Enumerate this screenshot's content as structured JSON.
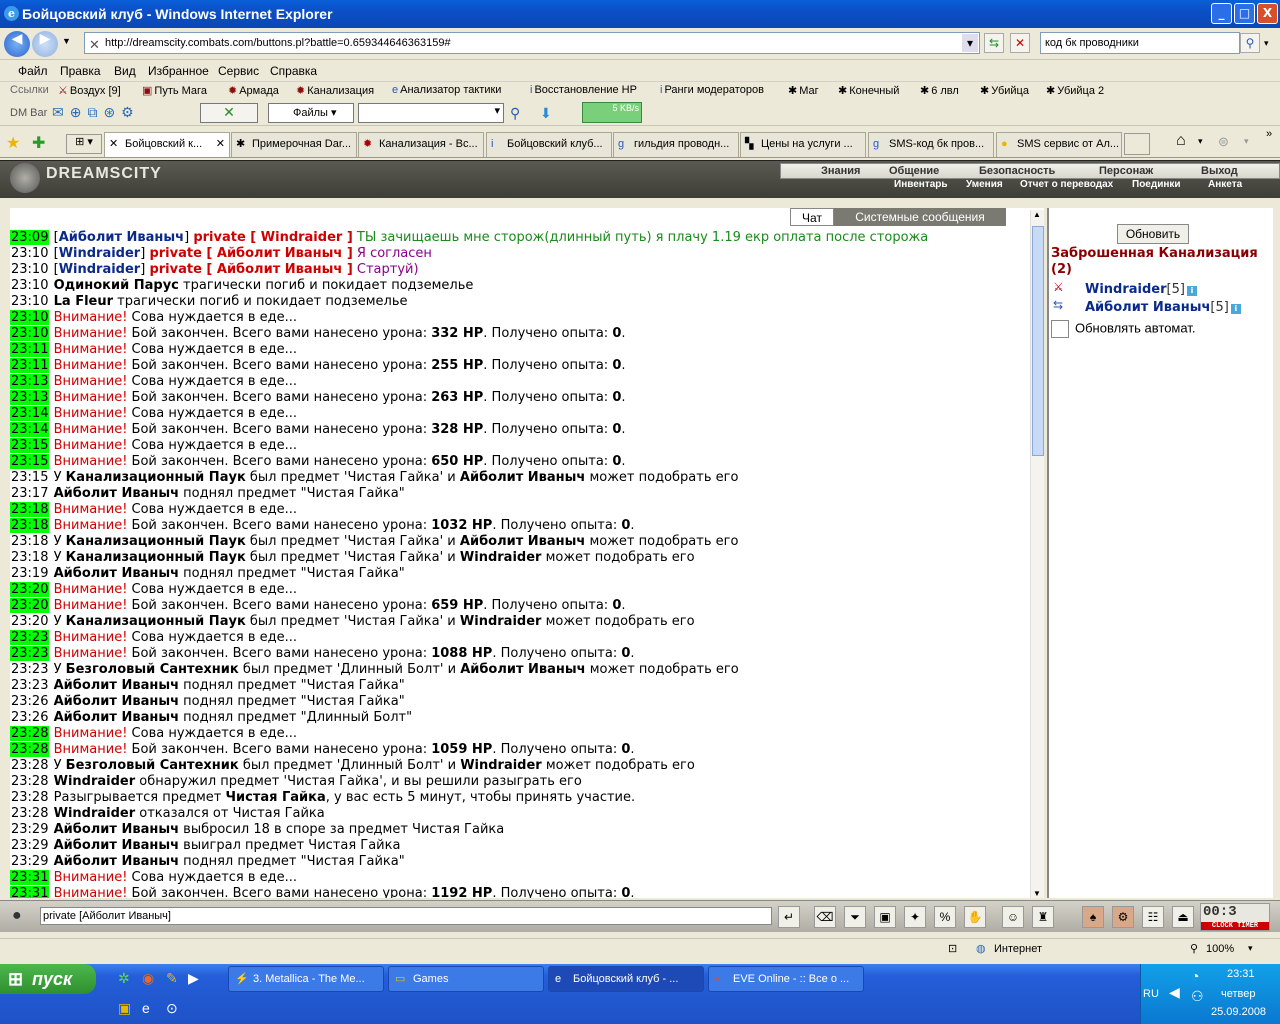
{
  "window": {
    "title": "Бойцовский клуб - Windows Internet Explorer",
    "min": "_",
    "max": "□",
    "close": "X"
  },
  "address": {
    "url": "http://dreamscity.combats.com/buttons.pl?battle=0.659344646363159#",
    "search": "код бк проводники"
  },
  "menu": [
    "Файл",
    "Правка",
    "Вид",
    "Избранное",
    "Сервис",
    "Справка"
  ],
  "links": {
    "label": "Ссылки",
    "items": [
      "Воздух [9]",
      "Путь Мага",
      "Армада",
      "Канализация",
      "Анализатор тактики",
      "Восстановление НР",
      "Ранги модераторов",
      "Маг",
      "Конечный",
      "6 лвл",
      "Убийца",
      "Убийца 2"
    ]
  },
  "dmbar": {
    "label": "DM Bar",
    "files": "Файлы",
    "speed": "5 KB/s"
  },
  "tabs": [
    "Бойцовский к...",
    "Примерочная Dar...",
    "Канализация - Вс...",
    "Бойцовский клуб...",
    "гильдия проводн...",
    "Цены на услуги ...",
    "SMS-код бк пров...",
    "SMS сервис от Ал..."
  ],
  "game": {
    "logo": "DREAMSCITY",
    "nav_top": [
      "Знания",
      "Общение",
      "Безопасность",
      "Персонаж",
      "Выход"
    ],
    "nav_bottom": [
      "Инвентарь",
      "Умения",
      "Отчет о переводах",
      "Поединки",
      "Анкета"
    ],
    "chat_tabs": [
      "Чат",
      "Системные сообщения"
    ]
  },
  "chat": [
    {
      "t": "23:09",
      "g": true,
      "parts": [
        [
          "",
          "["
        ],
        [
          "nm",
          "Айболит Иваныч"
        ],
        [
          "",
          "] "
        ],
        [
          "pr",
          "private [ Windraider ]"
        ],
        [
          "msg",
          " ТЫ зачищаешь мне сторож(длинный путь) я плачу 1.19 екр оплата после сторожа"
        ]
      ]
    },
    {
      "t": "23:10",
      "g": false,
      "parts": [
        [
          "",
          "["
        ],
        [
          "nm",
          "Windraider"
        ],
        [
          "",
          "] "
        ],
        [
          "pr",
          "private [ Айболит Иваныч ]"
        ],
        [
          "msg p",
          " Я согласен"
        ]
      ]
    },
    {
      "t": "23:10",
      "g": false,
      "parts": [
        [
          "",
          "["
        ],
        [
          "nm",
          "Windraider"
        ],
        [
          "",
          "] "
        ],
        [
          "pr",
          "private [ Айболит Иваныч ]"
        ],
        [
          "msg p",
          " Стартуй)"
        ]
      ]
    },
    {
      "t": "23:10",
      "g": false,
      "parts": [
        [
          "b",
          "Одинокий Парус"
        ],
        [
          "",
          " трагически погиб и покидает подземелье"
        ]
      ]
    },
    {
      "t": "23:10",
      "g": false,
      "parts": [
        [
          "b",
          "La Fleur"
        ],
        [
          "",
          " трагически погиб и покидает подземелье"
        ]
      ]
    },
    {
      "t": "23:10",
      "g": true,
      "parts": [
        [
          "warn",
          "Внимание!"
        ],
        [
          "",
          " Сова нуждается в еде..."
        ]
      ]
    },
    {
      "t": "23:10",
      "g": true,
      "parts": [
        [
          "warn",
          "Внимание!"
        ],
        [
          "",
          " Бой закончен. Всего вами нанесено урона: "
        ],
        [
          "b",
          "332 HP"
        ],
        [
          "",
          ". Получено опыта: "
        ],
        [
          "b",
          "0"
        ],
        [
          "",
          "."
        ]
      ]
    },
    {
      "t": "23:11",
      "g": true,
      "parts": [
        [
          "warn",
          "Внимание!"
        ],
        [
          "",
          " Сова нуждается в еде..."
        ]
      ]
    },
    {
      "t": "23:11",
      "g": true,
      "parts": [
        [
          "warn",
          "Внимание!"
        ],
        [
          "",
          " Бой закончен. Всего вами нанесено урона: "
        ],
        [
          "b",
          "255 HP"
        ],
        [
          "",
          ". Получено опыта: "
        ],
        [
          "b",
          "0"
        ],
        [
          "",
          "."
        ]
      ]
    },
    {
      "t": "23:13",
      "g": true,
      "parts": [
        [
          "warn",
          "Внимание!"
        ],
        [
          "",
          " Сова нуждается в еде..."
        ]
      ]
    },
    {
      "t": "23:13",
      "g": true,
      "parts": [
        [
          "warn",
          "Внимание!"
        ],
        [
          "",
          " Бой закончен. Всего вами нанесено урона: "
        ],
        [
          "b",
          "263 HP"
        ],
        [
          "",
          ". Получено опыта: "
        ],
        [
          "b",
          "0"
        ],
        [
          "",
          "."
        ]
      ]
    },
    {
      "t": "23:14",
      "g": true,
      "parts": [
        [
          "warn",
          "Внимание!"
        ],
        [
          "",
          " Сова нуждается в еде..."
        ]
      ]
    },
    {
      "t": "23:14",
      "g": true,
      "parts": [
        [
          "warn",
          "Внимание!"
        ],
        [
          "",
          " Бой закончен. Всего вами нанесено урона: "
        ],
        [
          "b",
          "328 HP"
        ],
        [
          "",
          ". Получено опыта: "
        ],
        [
          "b",
          "0"
        ],
        [
          "",
          "."
        ]
      ]
    },
    {
      "t": "23:15",
      "g": true,
      "parts": [
        [
          "warn",
          "Внимание!"
        ],
        [
          "",
          " Сова нуждается в еде..."
        ]
      ]
    },
    {
      "t": "23:15",
      "g": true,
      "parts": [
        [
          "warn",
          "Внимание!"
        ],
        [
          "",
          " Бой закончен. Всего вами нанесено урона: "
        ],
        [
          "b",
          "650 HP"
        ],
        [
          "",
          ". Получено опыта: "
        ],
        [
          "b",
          "0"
        ],
        [
          "",
          "."
        ]
      ]
    },
    {
      "t": "23:15",
      "g": false,
      "parts": [
        [
          "",
          "У "
        ],
        [
          "b",
          "Канализационный Паук"
        ],
        [
          "",
          " был предмет 'Чистая Гайка' и "
        ],
        [
          "b",
          "Айболит Иваныч"
        ],
        [
          "",
          " может подобрать его"
        ]
      ]
    },
    {
      "t": "23:17",
      "g": false,
      "parts": [
        [
          "b",
          "Айболит Иваныч"
        ],
        [
          "",
          " поднял предмет \"Чистая Гайка\""
        ]
      ]
    },
    {
      "t": "23:18",
      "g": true,
      "parts": [
        [
          "warn",
          "Внимание!"
        ],
        [
          "",
          " Сова нуждается в еде..."
        ]
      ]
    },
    {
      "t": "23:18",
      "g": true,
      "parts": [
        [
          "warn",
          "Внимание!"
        ],
        [
          "",
          " Бой закончен. Всего вами нанесено урона: "
        ],
        [
          "b",
          "1032 HP"
        ],
        [
          "",
          ". Получено опыта: "
        ],
        [
          "b",
          "0"
        ],
        [
          "",
          "."
        ]
      ]
    },
    {
      "t": "23:18",
      "g": false,
      "parts": [
        [
          "",
          "У "
        ],
        [
          "b",
          "Канализационный Паук"
        ],
        [
          "",
          " был предмет 'Чистая Гайка' и "
        ],
        [
          "b",
          "Айболит Иваныч"
        ],
        [
          "",
          " может подобрать его"
        ]
      ]
    },
    {
      "t": "23:18",
      "g": false,
      "parts": [
        [
          "",
          "У "
        ],
        [
          "b",
          "Канализационный Паук"
        ],
        [
          "",
          " был предмет 'Чистая Гайка' и "
        ],
        [
          "b",
          "Windraider"
        ],
        [
          "",
          " может подобрать его"
        ]
      ]
    },
    {
      "t": "23:19",
      "g": false,
      "parts": [
        [
          "b",
          "Айболит Иваныч"
        ],
        [
          "",
          " поднял предмет \"Чистая Гайка\""
        ]
      ]
    },
    {
      "t": "23:20",
      "g": true,
      "parts": [
        [
          "warn",
          "Внимание!"
        ],
        [
          "",
          " Сова нуждается в еде..."
        ]
      ]
    },
    {
      "t": "23:20",
      "g": true,
      "parts": [
        [
          "warn",
          "Внимание!"
        ],
        [
          "",
          " Бой закончен. Всего вами нанесено урона: "
        ],
        [
          "b",
          "659 HP"
        ],
        [
          "",
          ". Получено опыта: "
        ],
        [
          "b",
          "0"
        ],
        [
          "",
          "."
        ]
      ]
    },
    {
      "t": "23:20",
      "g": false,
      "parts": [
        [
          "",
          "У "
        ],
        [
          "b",
          "Канализационный Паук"
        ],
        [
          "",
          " был предмет 'Чистая Гайка' и "
        ],
        [
          "b",
          "Windraider"
        ],
        [
          "",
          " может подобрать его"
        ]
      ]
    },
    {
      "t": "23:23",
      "g": true,
      "parts": [
        [
          "warn",
          "Внимание!"
        ],
        [
          "",
          " Сова нуждается в еде..."
        ]
      ]
    },
    {
      "t": "23:23",
      "g": true,
      "parts": [
        [
          "warn",
          "Внимание!"
        ],
        [
          "",
          " Бой закончен. Всего вами нанесено урона: "
        ],
        [
          "b",
          "1088 HP"
        ],
        [
          "",
          ". Получено опыта: "
        ],
        [
          "b",
          "0"
        ],
        [
          "",
          "."
        ]
      ]
    },
    {
      "t": "23:23",
      "g": false,
      "parts": [
        [
          "",
          "У "
        ],
        [
          "b",
          "Безголовый Сантехник"
        ],
        [
          "",
          " был предмет 'Длинный Болт' и "
        ],
        [
          "b",
          "Айболит Иваныч"
        ],
        [
          "",
          " может подобрать его"
        ]
      ]
    },
    {
      "t": "23:23",
      "g": false,
      "parts": [
        [
          "b",
          "Айболит Иваныч"
        ],
        [
          "",
          " поднял предмет \"Чистая Гайка\""
        ]
      ]
    },
    {
      "t": "23:26",
      "g": false,
      "parts": [
        [
          "b",
          "Айболит Иваныч"
        ],
        [
          "",
          " поднял предмет \"Чистая Гайка\""
        ]
      ]
    },
    {
      "t": "23:26",
      "g": false,
      "parts": [
        [
          "b",
          "Айболит Иваныч"
        ],
        [
          "",
          " поднял предмет \"Длинный Болт\""
        ]
      ]
    },
    {
      "t": "23:28",
      "g": true,
      "parts": [
        [
          "warn",
          "Внимание!"
        ],
        [
          "",
          " Сова нуждается в еде..."
        ]
      ]
    },
    {
      "t": "23:28",
      "g": true,
      "parts": [
        [
          "warn",
          "Внимание!"
        ],
        [
          "",
          " Бой закончен. Всего вами нанесено урона: "
        ],
        [
          "b",
          "1059 HP"
        ],
        [
          "",
          ". Получено опыта: "
        ],
        [
          "b",
          "0"
        ],
        [
          "",
          "."
        ]
      ]
    },
    {
      "t": "23:28",
      "g": false,
      "parts": [
        [
          "",
          "У "
        ],
        [
          "b",
          "Безголовый Сантехник"
        ],
        [
          "",
          " был предмет 'Длинный Болт' и "
        ],
        [
          "b",
          "Windraider"
        ],
        [
          "",
          " может подобрать его"
        ]
      ]
    },
    {
      "t": "23:28",
      "g": false,
      "parts": [
        [
          "b",
          "Windraider"
        ],
        [
          "",
          " обнаружил предмет 'Чистая Гайка', и вы решили разыграть его"
        ]
      ]
    },
    {
      "t": "23:28",
      "g": false,
      "parts": [
        [
          "",
          "Разыгрывается предмет "
        ],
        [
          "b",
          "Чистая Гайка"
        ],
        [
          "",
          ", у вас есть 5 минут, чтобы принять участие."
        ]
      ]
    },
    {
      "t": "23:28",
      "g": false,
      "parts": [
        [
          "b",
          "Windraider"
        ],
        [
          "",
          " отказался от Чистая Гайка"
        ]
      ]
    },
    {
      "t": "23:29",
      "g": false,
      "parts": [
        [
          "b",
          "Айболит Иваныч"
        ],
        [
          "",
          " выбросил 18 в споре за предмет Чистая Гайка"
        ]
      ]
    },
    {
      "t": "23:29",
      "g": false,
      "parts": [
        [
          "b",
          "Айболит Иваныч"
        ],
        [
          "",
          " выиграл предмет Чистая Гайка"
        ]
      ]
    },
    {
      "t": "23:29",
      "g": false,
      "parts": [
        [
          "b",
          "Айболит Иваныч"
        ],
        [
          "",
          " поднял предмет \"Чистая Гайка\""
        ]
      ]
    },
    {
      "t": "23:31",
      "g": true,
      "parts": [
        [
          "warn",
          "Внимание!"
        ],
        [
          "",
          " Сова нуждается в еде..."
        ]
      ]
    },
    {
      "t": "23:31",
      "g": true,
      "parts": [
        [
          "warn",
          "Внимание!"
        ],
        [
          "",
          " Бой закончен. Всего вами нанесено урона: "
        ],
        [
          "b",
          "1192 HP"
        ],
        [
          "",
          ". Получено опыта: "
        ],
        [
          "b",
          "0"
        ],
        [
          "",
          "."
        ]
      ]
    }
  ],
  "panel": {
    "refresh": "Обновить",
    "location": "Заброшенная Канализация (2)",
    "people": [
      {
        "name": "Windraider",
        "level": "[5]"
      },
      {
        "name": "Айболит Иваныч",
        "level": "[5]"
      }
    ],
    "auto": "Обновлять автомат."
  },
  "input": {
    "value": "private [Айболит Иваныч]"
  },
  "clock": {
    "value": "00:3",
    "label": "CLOCK TIMER"
  },
  "status": {
    "zone": "Интернет",
    "zoom": "100%"
  },
  "taskbar": {
    "start": "пуск",
    "tasks": [
      "3. Metallica - The Me...",
      "Games",
      "Бойцовский клуб - ...",
      "EVE Online - :: Все о ..."
    ],
    "lang": "RU",
    "time": "23:31",
    "day": "четвер",
    "date": "25.09.2008"
  },
  "colors": {
    "timestamp_highlight": "#00ff00",
    "warning": "#d00000",
    "nick": "#0a2a8a"
  }
}
